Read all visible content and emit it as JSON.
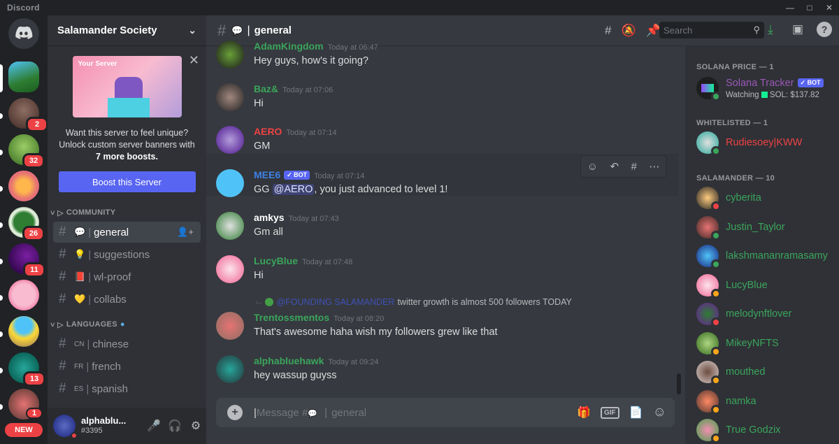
{
  "window": {
    "app_name": "Discord"
  },
  "server": {
    "name": "Salamander Society",
    "boost_card": {
      "label": "Your Server",
      "text_line1": "Want this server to feel unique?",
      "text_line2": "Unlock custom server banners with",
      "text_bold": "7 more boosts.",
      "button": "Boost this Server"
    },
    "categories": [
      {
        "name": "COMMUNITY",
        "channels": [
          {
            "emoji": "💬",
            "label": "general",
            "active": true
          },
          {
            "emoji": "💡",
            "label": "suggestions"
          },
          {
            "emoji": "📕",
            "label": "wl-proof"
          },
          {
            "emoji": "💛",
            "label": "collabs"
          }
        ]
      },
      {
        "name": "LANGUAGES",
        "channels": [
          {
            "emoji": "CN",
            "label": "chinese"
          },
          {
            "emoji": "FR",
            "label": "french"
          },
          {
            "emoji": "ES",
            "label": "spanish"
          }
        ]
      }
    ]
  },
  "rail_badges": [
    "2",
    "32",
    "26",
    "11",
    "13",
    "1"
  ],
  "rail_new": "NEW",
  "user": {
    "name": "alphablu...",
    "tag": "#3395"
  },
  "header": {
    "channel": "general",
    "search_placeholder": "Search"
  },
  "messages": [
    {
      "author": "AdamKingdom",
      "time": "Today at 06:47",
      "text": "Hey guys, how's it going?",
      "color": "#3ba55c"
    },
    {
      "author": "Baz&",
      "time": "Today at 07:06",
      "text": "Hi",
      "color": "#3ba55c"
    },
    {
      "author": "AERO",
      "time": "Today at 07:14",
      "text": "GM",
      "color": "#ed4245"
    },
    {
      "author": "MEE6",
      "bot": "BOT",
      "time": "Today at 07:14",
      "text_pre": "GG ",
      "mention": "@AERO",
      "text_post": ", you just advanced to level 1!",
      "color": "#3e82e5"
    },
    {
      "author": "amkys",
      "time": "Today at 07:43",
      "text": "Gm all",
      "color": "#ffffff"
    },
    {
      "author": "LucyBlue",
      "time": "Today at 07:48",
      "text": "Hi",
      "color": "#3ba55c"
    },
    {
      "reply_author": "@FOUNDING SALAMANDER",
      "reply_text": "twitter growth is almost 500 followers TODAY",
      "author": "Trentossmentos",
      "time": "Today at 08:20",
      "text": "That's awesome haha wish my followers grew like that",
      "color": "#3ba55c"
    },
    {
      "author": "alphabluehawk",
      "time": "Today at 09:24",
      "text": "hey wassup guyss",
      "color": "#3ba55c"
    }
  ],
  "composer": {
    "placeholder_pre": "Message #",
    "placeholder_channel": "general",
    "gif_label": "GIF"
  },
  "members": {
    "groups": [
      {
        "title": "SOLANA PRICE — 1",
        "items": [
          {
            "name": "Solana Tracker",
            "bot": "BOT",
            "activity": "Watching",
            "activity_value": "SOL: $137.82",
            "color": "#9b59b6"
          }
        ]
      },
      {
        "title": "WHITELISTED — 1",
        "items": [
          {
            "name": "Rudiesoey|KWW",
            "color": "#ed4245"
          }
        ]
      },
      {
        "title": "SALAMANDER — 10",
        "items": [
          {
            "name": "cyberita",
            "color": "#3ba55c"
          },
          {
            "name": "Justin_Taylor",
            "color": "#3ba55c"
          },
          {
            "name": "lakshmananramasamy",
            "color": "#3ba55c"
          },
          {
            "name": "LucyBlue",
            "color": "#3ba55c"
          },
          {
            "name": "melodynftlover",
            "color": "#3ba55c"
          },
          {
            "name": "MikeyNFTS",
            "color": "#3ba55c"
          },
          {
            "name": "mouthed",
            "color": "#3ba55c"
          },
          {
            "name": "namka",
            "color": "#3ba55c"
          },
          {
            "name": "True Godzix",
            "color": "#3ba55c"
          }
        ]
      }
    ]
  },
  "colors": {
    "blurple": "#5865f2",
    "green": "#3ba55c",
    "red": "#ed4245"
  }
}
